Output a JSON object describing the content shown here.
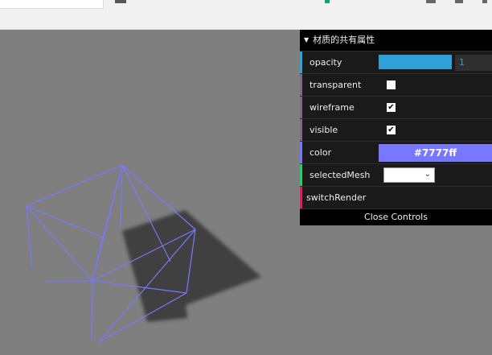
{
  "gui": {
    "title": "材质的共有属性",
    "close_label": "Close Controls",
    "rows": {
      "opacity": {
        "label": "opacity",
        "value": "1",
        "fill_fraction": 1.0,
        "stripe": "#2fa1d6"
      },
      "transparent": {
        "label": "transparent",
        "checked": false,
        "stripe": "#806787"
      },
      "wireframe": {
        "label": "wireframe",
        "checked": true,
        "check_glyph": "✔",
        "stripe": "#806787"
      },
      "visible": {
        "label": "visible",
        "checked": true,
        "check_glyph": "✔",
        "stripe": "#806787"
      },
      "color": {
        "label": "color",
        "value": "#7777ff",
        "stripe": "#7777ff"
      },
      "selectedMesh": {
        "label": "selectedMesh",
        "value": "",
        "stripe": "#1ed36f"
      },
      "switchRender": {
        "label": "switchRender",
        "stripe": "#e61d5f"
      }
    }
  },
  "scene": {
    "background": "#7f7f7f",
    "wire_color": "#7777ff",
    "shadow_color": "#3a3a3a"
  }
}
